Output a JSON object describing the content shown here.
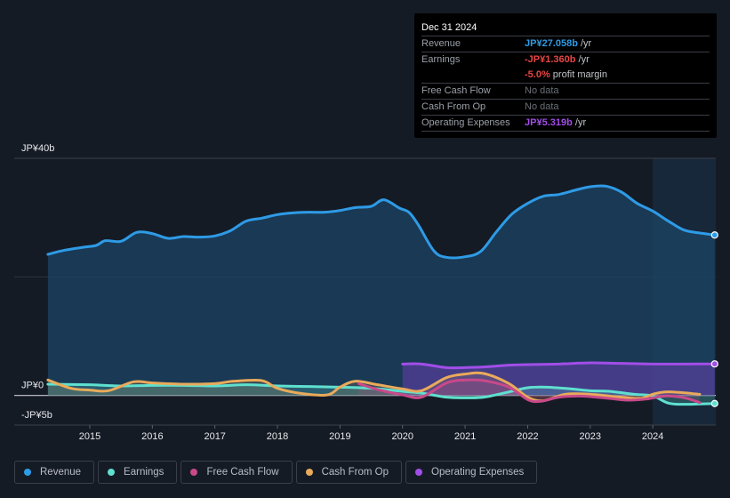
{
  "tooltip": {
    "date": "Dec 31 2024",
    "rows": [
      {
        "label": "Revenue",
        "value": "JP¥27.058b",
        "unit": " /yr",
        "color": "#2e9be6"
      },
      {
        "label": "Earnings",
        "value": "-JP¥1.360b",
        "unit": " /yr",
        "color": "#e84545"
      },
      {
        "label": "",
        "value": "-5.0%",
        "unit": " profit margin",
        "color": "#e84545"
      },
      {
        "label": "Free Cash Flow",
        "value": "No data",
        "unit": "",
        "color": "#6b7078"
      },
      {
        "label": "Cash From Op",
        "value": "No data",
        "unit": "",
        "color": "#6b7078"
      },
      {
        "label": "Operating Expenses",
        "value": "JP¥5.319b",
        "unit": " /yr",
        "color": "#a14ee8"
      }
    ]
  },
  "legend": [
    {
      "label": "Revenue",
      "color": "#2e9be6"
    },
    {
      "label": "Earnings",
      "color": "#5fe0cf"
    },
    {
      "label": "Free Cash Flow",
      "color": "#c8498a"
    },
    {
      "label": "Cash From Op",
      "color": "#e9aa5a"
    },
    {
      "label": "Operating Expenses",
      "color": "#a14ee8"
    }
  ],
  "chart_data": {
    "type": "line",
    "title": "",
    "xlabel": "",
    "ylabel": "",
    "y_tick_labels": [
      "JP¥40b",
      "JP¥0",
      "-JP¥5b"
    ],
    "y_ticks": [
      40,
      0,
      -5
    ],
    "ylim": [
      -5,
      40
    ],
    "xlim": [
      2014.33,
      2025.0
    ],
    "x_tick_labels": [
      "2015",
      "2016",
      "2017",
      "2018",
      "2019",
      "2020",
      "2021",
      "2022",
      "2023",
      "2024"
    ],
    "x_ticks": [
      2015,
      2016,
      2017,
      2018,
      2019,
      2020,
      2021,
      2022,
      2023,
      2024
    ],
    "highlight_start": 2024.0,
    "grid": true,
    "legend_position": "bottom-left",
    "series": [
      {
        "name": "Revenue",
        "color": "#2e9be6",
        "x": [
          2014.33,
          2014.6,
          2014.9,
          2015.1,
          2015.25,
          2015.5,
          2015.75,
          2016.0,
          2016.25,
          2016.5,
          2016.75,
          2017.0,
          2017.25,
          2017.5,
          2017.75,
          2018.0,
          2018.25,
          2018.5,
          2018.75,
          2019.0,
          2019.25,
          2019.5,
          2019.7,
          2019.95,
          2020.1,
          2020.25,
          2020.5,
          2020.7,
          2021.0,
          2021.25,
          2021.5,
          2021.75,
          2022.0,
          2022.25,
          2022.5,
          2022.75,
          2023.0,
          2023.25,
          2023.5,
          2023.75,
          2024.0,
          2024.25,
          2024.5,
          2024.75,
          2024.99
        ],
        "values": [
          23.8,
          24.5,
          25.0,
          25.3,
          26.1,
          26.0,
          27.5,
          27.3,
          26.5,
          26.8,
          26.7,
          26.9,
          27.8,
          29.4,
          29.9,
          30.5,
          30.8,
          30.9,
          30.9,
          31.2,
          31.7,
          31.9,
          33.0,
          31.6,
          30.9,
          28.8,
          24.4,
          23.3,
          23.4,
          24.3,
          27.6,
          30.6,
          32.4,
          33.6,
          33.9,
          34.6,
          35.2,
          35.3,
          34.3,
          32.4,
          31.1,
          29.4,
          27.9,
          27.4,
          27.06
        ]
      },
      {
        "name": "Earnings",
        "color": "#5fe0cf",
        "x": [
          2014.33,
          2015.0,
          2015.5,
          2016.0,
          2016.5,
          2017.0,
          2017.5,
          2018.0,
          2018.5,
          2019.0,
          2019.5,
          2020.0,
          2020.3,
          2020.7,
          2021.0,
          2021.3,
          2021.7,
          2022.0,
          2022.3,
          2022.7,
          2023.0,
          2023.3,
          2023.7,
          2024.0,
          2024.25,
          2024.5,
          2024.99
        ],
        "values": [
          1.9,
          1.8,
          1.6,
          1.7,
          1.7,
          1.6,
          1.8,
          1.6,
          1.5,
          1.4,
          1.2,
          0.7,
          0.4,
          -0.3,
          -0.4,
          -0.3,
          0.6,
          1.3,
          1.4,
          1.1,
          0.8,
          0.7,
          0.2,
          -0.1,
          -1.3,
          -1.5,
          -1.36
        ]
      },
      {
        "name": "Free Cash Flow",
        "color": "#c8498a",
        "x": [
          2019.3,
          2019.6,
          2020.0,
          2020.3,
          2020.7,
          2021.0,
          2021.3,
          2021.7,
          2022.0,
          2022.2,
          2022.5,
          2022.8,
          2023.0,
          2023.3,
          2023.6,
          2023.9,
          2024.2,
          2024.5,
          2024.75
        ],
        "values": [
          2.0,
          1.0,
          0.1,
          -0.3,
          2.1,
          2.6,
          2.5,
          1.4,
          -0.7,
          -1.0,
          -0.3,
          -0.1,
          -0.2,
          -0.5,
          -0.8,
          -0.6,
          -0.1,
          -0.4,
          -1.2
        ]
      },
      {
        "name": "Cash From Op",
        "color": "#e9aa5a",
        "x": [
          2014.33,
          2014.7,
          2015.0,
          2015.3,
          2015.7,
          2016.0,
          2016.5,
          2017.0,
          2017.3,
          2017.75,
          2018.0,
          2018.4,
          2018.8,
          2019.0,
          2019.25,
          2019.6,
          2020.0,
          2020.3,
          2020.7,
          2021.0,
          2021.3,
          2021.7,
          2022.0,
          2022.25,
          2022.6,
          2023.0,
          2023.4,
          2023.8,
          2024.0,
          2024.25,
          2024.75
        ],
        "values": [
          2.6,
          1.2,
          0.9,
          0.8,
          2.3,
          2.1,
          1.9,
          2.0,
          2.4,
          2.5,
          1.2,
          0.3,
          0.1,
          1.4,
          2.4,
          1.8,
          1.1,
          0.8,
          3.0,
          3.6,
          3.7,
          2.0,
          -0.3,
          -0.9,
          0.2,
          0.2,
          -0.2,
          -0.5,
          0.2,
          0.6,
          0.2
        ]
      },
      {
        "name": "Operating Expenses",
        "color": "#a14ee8",
        "x": [
          2020.0,
          2020.3,
          2020.7,
          2021.0,
          2021.3,
          2021.7,
          2022.0,
          2022.5,
          2023.0,
          2023.5,
          2024.0,
          2024.5,
          2024.99
        ],
        "values": [
          5.3,
          5.3,
          4.7,
          4.7,
          4.8,
          5.1,
          5.2,
          5.3,
          5.5,
          5.4,
          5.3,
          5.3,
          5.32
        ]
      }
    ]
  }
}
